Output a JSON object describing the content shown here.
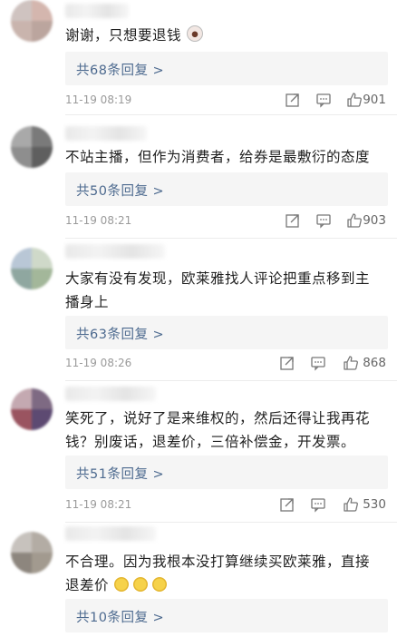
{
  "comments": [
    {
      "text": "谢谢，只想要退钱",
      "replies_label": "共68条回复 >",
      "time": "11-19 08:19",
      "likes": "901",
      "avatar_colors": [
        "#cfc3c0",
        "#d4b6ae",
        "#c9b4ad",
        "#bba59e"
      ],
      "emoji": [
        "surprised-face-icon"
      ]
    },
    {
      "text": "不站主播，但作为消费者，给券是最敷衍的态度",
      "replies_label": "共50条回复 >",
      "time": "11-19 08:21",
      "likes": "903",
      "avatar_colors": [
        "#a9a9a9",
        "#7a7a7a",
        "#8e8e8e",
        "#5f5f5f"
      ],
      "emoji": []
    },
    {
      "text": "大家有没有发现，欧莱雅找人评论把重点移到主播身上",
      "replies_label": "共63条回复 >",
      "time": "11-19 08:26",
      "likes": "868",
      "avatar_colors": [
        "#b9c7d6",
        "#cfd9c9",
        "#8fa7a0",
        "#a3b79a"
      ],
      "emoji": []
    },
    {
      "text": "笑死了，说好了是来维权的，然后还得让我再花钱？别废话，退差价，三倍补偿金，开发票。",
      "replies_label": "共51条回复 >",
      "time": "11-19 08:21",
      "likes": "530",
      "avatar_colors": [
        "#c4a9b1",
        "#7e6a83",
        "#9a5460",
        "#5d4a72"
      ],
      "emoji": []
    },
    {
      "text": "不合理。因为我根本没打算继续买欧莱雅，直接退差价",
      "replies_label": "共10条回复 >",
      "time": "",
      "likes": "",
      "avatar_colors": [
        "#c7c2bd",
        "#b3aca4",
        "#8d867e",
        "#a29a8f"
      ],
      "emoji": [
        "slight-smile-icon",
        "slight-smile-icon",
        "slight-smile-icon"
      ]
    }
  ]
}
